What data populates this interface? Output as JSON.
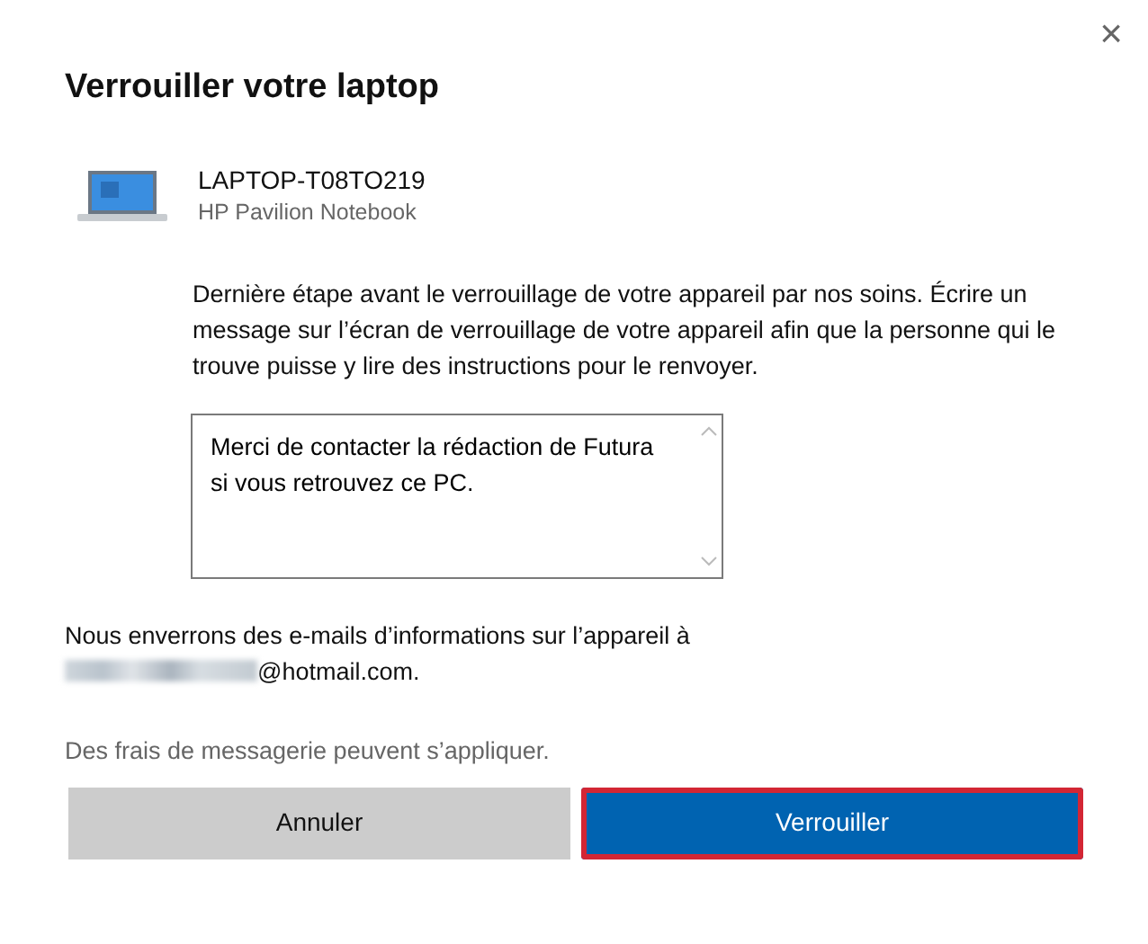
{
  "dialog": {
    "close": "×",
    "title": "Verrouiller votre laptop"
  },
  "device": {
    "name": "LAPTOP-T08TO219",
    "model": "HP Pavilion Notebook"
  },
  "instructions": "Dernière étape avant le verrouillage de votre appareil par nos soins. Écrire un message sur l’écran de verrouillage de votre appareil afin que la personne qui le trouve puisse y lire des instructions pour le renvoyer.",
  "message": {
    "value": "Merci de contacter la rédaction de Futura si vous retrouvez ce PC."
  },
  "email_notice": {
    "text": "Nous enverrons des e-mails d’informations sur l’appareil à",
    "address_redacted": true,
    "address": "@hotmail.com."
  },
  "fees_note": "Des frais de messagerie peuvent s’appliquer.",
  "buttons": [
    {
      "kind": "secondary",
      "label": "Annuler",
      "highlighted": false
    },
    {
      "kind": "primary",
      "label": "Verrouiller",
      "highlighted": true
    }
  ]
}
